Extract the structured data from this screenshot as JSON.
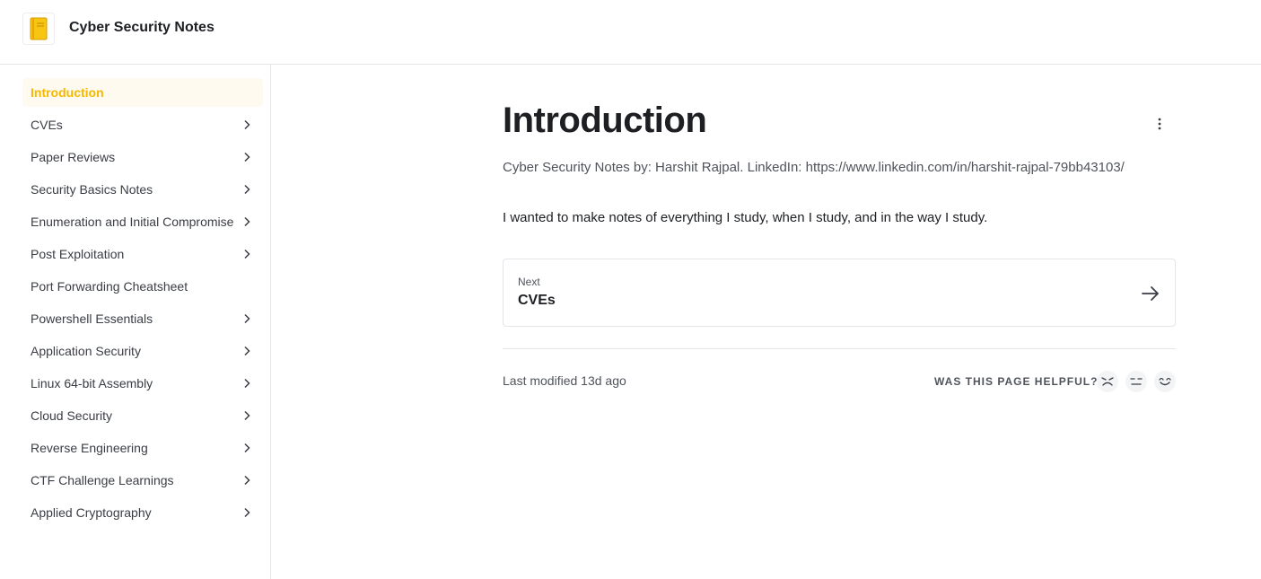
{
  "header": {
    "title": "Cyber Security Notes",
    "logo_icon": "notebook-icon"
  },
  "sidebar": {
    "active_color": "#f6b800",
    "items": [
      {
        "label": "Introduction",
        "active": true,
        "expandable": false
      },
      {
        "label": "CVEs",
        "expandable": true
      },
      {
        "label": "Paper Reviews",
        "expandable": true
      },
      {
        "label": "Security Basics Notes",
        "expandable": true
      },
      {
        "label": "Enumeration and Initial Compromise",
        "expandable": true
      },
      {
        "label": "Post Exploitation",
        "expandable": true
      },
      {
        "label": "Port Forwarding Cheatsheet",
        "expandable": false
      },
      {
        "label": "Powershell Essentials",
        "expandable": true
      },
      {
        "label": "Application Security",
        "expandable": true
      },
      {
        "label": "Linux 64-bit Assembly",
        "expandable": true
      },
      {
        "label": "Cloud Security",
        "expandable": true
      },
      {
        "label": "Reverse Engineering",
        "expandable": true
      },
      {
        "label": "CTF Challenge Learnings",
        "expandable": true
      },
      {
        "label": "Applied Cryptography",
        "expandable": true
      }
    ]
  },
  "main": {
    "title": "Introduction",
    "description": "Cyber Security Notes by: Harshit Rajpal. LinkedIn: https://www.linkedin.com/in/harshit-rajpal-79bb43103/",
    "paragraph": "I wanted to make notes of everything I study, when I study, and in the way I study.",
    "next": {
      "label": "Next",
      "title": "CVEs"
    },
    "footer": {
      "last_modified": "Last modified 13d ago",
      "helpful_label": "WAS THIS PAGE HELPFUL?",
      "ratings": [
        "sad-face-icon",
        "neutral-face-icon",
        "happy-face-icon"
      ]
    }
  }
}
